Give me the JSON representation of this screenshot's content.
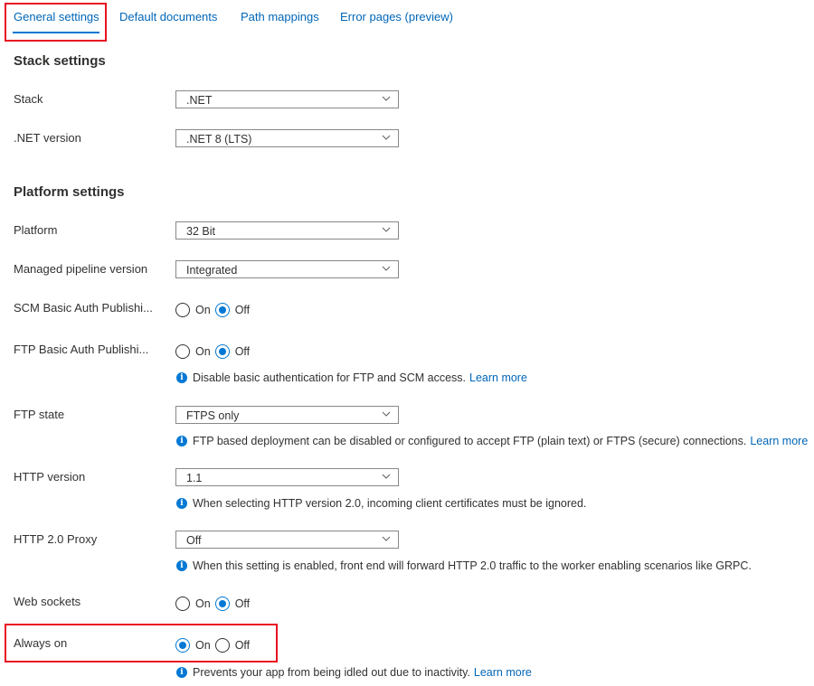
{
  "tabs": [
    {
      "label": "General settings",
      "active": true
    },
    {
      "label": "Default documents",
      "active": false
    },
    {
      "label": "Path mappings",
      "active": false
    },
    {
      "label": "Error pages (preview)",
      "active": false
    }
  ],
  "sections": {
    "stack": "Stack settings",
    "platform": "Platform settings"
  },
  "fields": {
    "stack": {
      "label": "Stack",
      "value": ".NET"
    },
    "dotnet_version": {
      "label": ".NET version",
      "value": ".NET 8 (LTS)"
    },
    "platform": {
      "label": "Platform",
      "value": "32 Bit"
    },
    "pipeline": {
      "label": "Managed pipeline version",
      "value": "Integrated"
    },
    "scm_auth": {
      "label": "SCM Basic Auth Publishi...",
      "selected": "Off"
    },
    "ftp_auth": {
      "label": "FTP Basic Auth Publishi...",
      "selected": "Off",
      "info": "Disable basic authentication for FTP and SCM access.",
      "link": "Learn more"
    },
    "ftp_state": {
      "label": "FTP state",
      "value": "FTPS only",
      "info": "FTP based deployment can be disabled or configured to accept FTP (plain text) or FTPS (secure) connections.",
      "link": "Learn more"
    },
    "http_version": {
      "label": "HTTP version",
      "value": "1.1",
      "info": "When selecting HTTP version 2.0, incoming client certificates must be ignored."
    },
    "http2_proxy": {
      "label": "HTTP 2.0 Proxy",
      "value": "Off",
      "info": "When this setting is enabled, front end will forward HTTP 2.0 traffic to the worker enabling scenarios like GRPC."
    },
    "web_sockets": {
      "label": "Web sockets",
      "selected": "Off"
    },
    "always_on": {
      "label": "Always on",
      "selected": "On",
      "info": "Prevents your app from being idled out due to inactivity.",
      "link": "Learn more"
    }
  },
  "radio_options": {
    "on": "On",
    "off": "Off"
  },
  "icons": {
    "chevron": "chevron-down-icon",
    "info": "info-icon"
  },
  "colors": {
    "accent": "#0078d4",
    "link": "#0066b8",
    "highlight": "#e81123"
  }
}
